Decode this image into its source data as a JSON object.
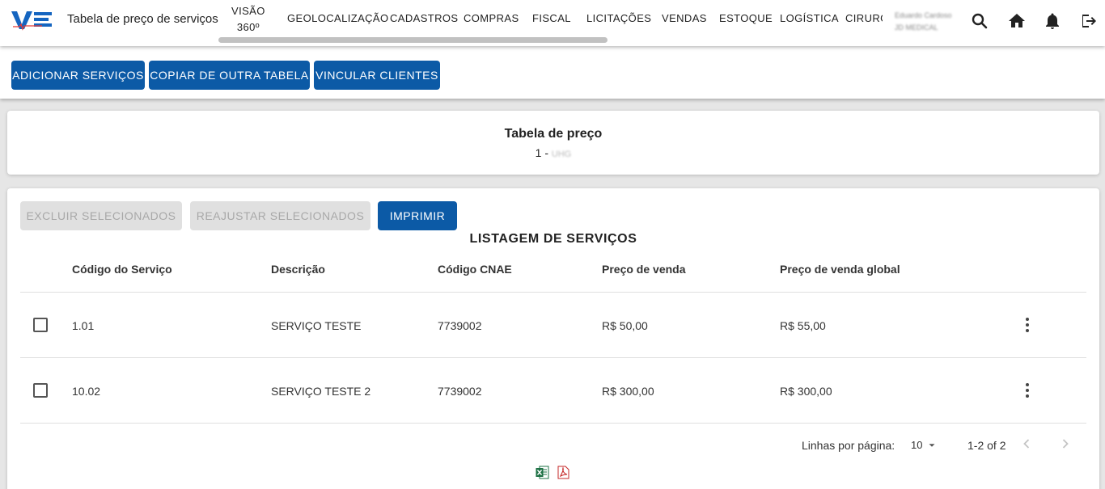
{
  "header": {
    "page_title": "Tabela de preço de serviços",
    "nav_items": [
      "VISÃO 360º",
      "GEOLOCALIZAÇÃO",
      "CADASTROS",
      "COMPRAS",
      "FISCAL",
      "LICITAÇÕES",
      "VENDAS",
      "ESTOQUE",
      "LOGÍSTICA",
      "CIRURG"
    ],
    "nav_visao_line1": "VISÃO",
    "nav_visao_line2": "360º",
    "user_name": "Eduardo Cardoso",
    "user_company": "JD MEDICAL",
    "icons": [
      "search-icon",
      "home-icon",
      "bell-icon",
      "logout-icon"
    ]
  },
  "actions": {
    "add_services": "ADICIONAR SERVIÇOS",
    "copy_table": "COPIAR DE OUTRA TABELA",
    "link_clients": "VINCULAR CLIENTES"
  },
  "price_table": {
    "title": "Tabela de preço",
    "id_prefix": "1 -",
    "name": "UHG"
  },
  "listing": {
    "delete_selected": "EXCLUIR SELECIONADOS",
    "adjust_selected": "REAJUSTAR SELECIONADOS",
    "print": "IMPRIMIR",
    "title": "LISTAGEM DE SERVIÇOS",
    "columns": [
      "Código do Serviço",
      "Descrição",
      "Código CNAE",
      "Preço de venda",
      "Preço de venda global"
    ],
    "rows": [
      {
        "code": "1.01",
        "description": "SERVIÇO TESTE",
        "cnae": "7739002",
        "price": "R$ 50,00",
        "global_price": "R$ 55,00"
      },
      {
        "code": "10.02",
        "description": "SERVIÇO TESTE 2",
        "cnae": "7739002",
        "price": "R$ 300,00",
        "global_price": "R$ 300,00"
      }
    ],
    "rows_per_page_label": "Linhas por página:",
    "rows_per_page_value": "10",
    "pagination_range": "1-2 of 2",
    "export_icons": [
      "excel-icon",
      "pdf-icon"
    ]
  },
  "colors": {
    "primary": "#0c5aa6",
    "disabled_bg": "#e0e0e0",
    "disabled_text": "#a8a8a8",
    "page_bg": "#e6e6e6"
  }
}
